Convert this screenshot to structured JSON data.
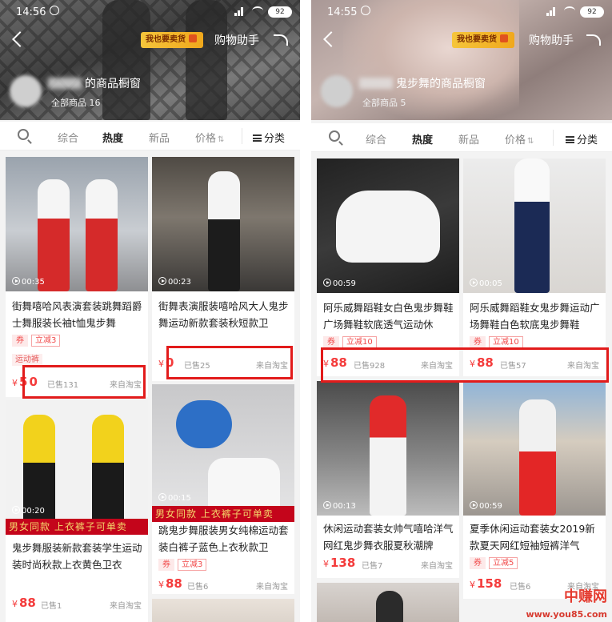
{
  "colors": {
    "accent": "#f43b3b",
    "highlight": "#e21b1b",
    "banner": "#c4051b"
  },
  "left": {
    "status": {
      "time": "14:56",
      "battery": "92"
    },
    "header": {
      "badge": "我也要卖货",
      "assist": "购物助手",
      "shop_name": "的商品橱窗",
      "shop_count": "全部商品 16"
    },
    "tabs": {
      "all": "综合",
      "hot": "热度",
      "new": "新品",
      "price": "价格",
      "sort_icon": "⇅",
      "category": "分类"
    },
    "cards": [
      {
        "duration": "00:35",
        "title": "街舞嘻哈风表演套装跳舞蹈爵士舞服装长袖t恤鬼步舞",
        "coupon": "券",
        "off": "立减3",
        "extra_tag": "运动裤",
        "currency": "¥",
        "price": "5",
        "price_tail": "0",
        "sold": "已售131",
        "from": "来自淘宝"
      },
      {
        "duration": "00:23",
        "title": "街舞表演服装嘻哈风大人鬼步舞运动新款套装秋短款卫",
        "coupon": "",
        "off": "",
        "extra_tag": "",
        "currency": "¥",
        "price": "",
        "price_tail": "0",
        "sold": "已售25",
        "from": "来自淘宝"
      },
      {
        "duration": "00:20",
        "banner": "男女同款 上衣裤子可单卖",
        "title": "鬼步舞服装新款套装学生运动装时尚秋款上衣黄色卫衣",
        "coupon": "",
        "off": "",
        "currency": "¥",
        "price": "88",
        "sold": "已售1",
        "from": "来自淘宝"
      },
      {
        "duration": "00:15",
        "banner": "男女同款 上衣裤子可单卖",
        "title": "跳鬼步舞服装男女纯棉运动套装白裤子蓝色上衣秋款卫",
        "coupon": "券",
        "off": "立减3",
        "currency": "¥",
        "price": "88",
        "sold": "已售6",
        "from": "来自淘宝"
      }
    ]
  },
  "right": {
    "status": {
      "time": "14:55",
      "battery": "92"
    },
    "header": {
      "badge": "我也要卖货",
      "assist": "购物助手",
      "shop_name": "鬼步舞的商品橱窗",
      "shop_count": "全部商品 5"
    },
    "tabs": {
      "all": "综合",
      "hot": "热度",
      "new": "新品",
      "price": "价格",
      "sort_icon": "⇅",
      "category": "分类"
    },
    "cards": [
      {
        "duration": "00:59",
        "title": "阿乐威舞蹈鞋女白色鬼步舞鞋广场舞鞋软底透气运动休",
        "coupon": "券",
        "off": "立减10",
        "currency": "¥",
        "price": "88",
        "sold": "已售928",
        "from": "来自淘宝"
      },
      {
        "duration": "00:05",
        "title": "阿乐威舞蹈鞋女鬼步舞运动广场舞鞋白色软底鬼步舞鞋",
        "coupon": "券",
        "off": "立减10",
        "currency": "¥",
        "price": "88",
        "sold": "已售57",
        "from": "来自淘宝"
      },
      {
        "duration": "00:13",
        "title": "休闲运动套装女帅气嘻哈洋气网红鬼步舞衣服夏秋潮牌",
        "coupon": "",
        "off": "",
        "currency": "¥",
        "price": "138",
        "sold": "已售7",
        "from": "来自淘宝"
      },
      {
        "duration": "00:59",
        "title": "夏季休闲运动套装女2019新款夏天网红短袖短裤洋气",
        "coupon": "券",
        "off": "立减5",
        "currency": "¥",
        "price": "158",
        "sold": "已售6",
        "from": "来自淘宝"
      }
    ]
  },
  "watermark": {
    "name": "中赚网",
    "url": "www.you85.com"
  }
}
